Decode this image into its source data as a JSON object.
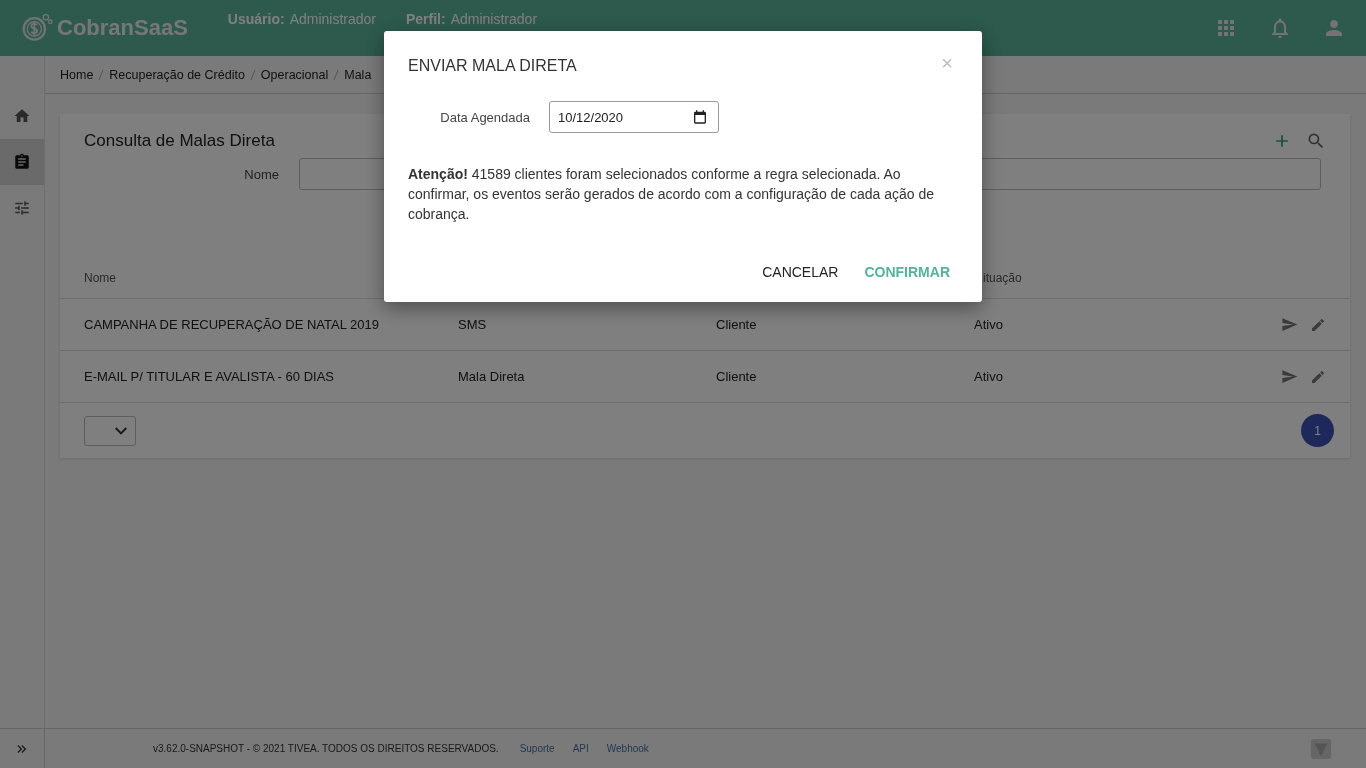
{
  "header": {
    "logo": "CobranSaaS",
    "user_label": "Usuário:",
    "user": "Administrador",
    "profile_label": "Perfil:",
    "profile": "Administrador"
  },
  "sidebar": {
    "items": [
      {
        "selected": false
      },
      {
        "selected": true
      },
      {
        "selected": false
      }
    ]
  },
  "breadcrumb": [
    "Home",
    "Recuperação de Crédito",
    "Operacional",
    "Mala"
  ],
  "card": {
    "title": "Consulta de Malas Direta",
    "filter_label": "Nome",
    "columns": {
      "column_1": "Nome",
      "column_4": "ituação"
    },
    "rows": [
      {
        "cells": [
          "CAMPANHA DE RECUPERAÇÃO DE NATAL 2019",
          "SMS",
          "Cliente",
          "Ativo"
        ]
      },
      {
        "cells": [
          "E-MAIL P/ TITULAR E AVALISTA - 60 DIAS",
          "Mala Direta",
          "Cliente",
          "Ativo"
        ]
      }
    ],
    "pages": [
      {
        "label": "1",
        "selected": true
      }
    ]
  },
  "footer": {
    "version": "v3.62.0-SNAPSHOT - © 2021 TIVEA. TODOS OS DIREITOS RESERVADOS.",
    "links": [
      "Suporte",
      "API",
      "Webhook"
    ]
  },
  "modal": {
    "title": "ENVIAR MALA DIRETA",
    "close": "×",
    "date_label": "Data Agendada",
    "date_value": "10/12/2020",
    "message": "**Atenção!** 41589 clientes foram selecionados conforme a regra selecionada. Ao confirmar, os eventos serão gerados de acordo com a configuração de cada ação de cobrança.",
    "buttons": [
      {
        "label": "CANCELAR",
        "kind": "plain"
      },
      {
        "label": "CONFIRMAR",
        "kind": "primary"
      }
    ]
  }
}
